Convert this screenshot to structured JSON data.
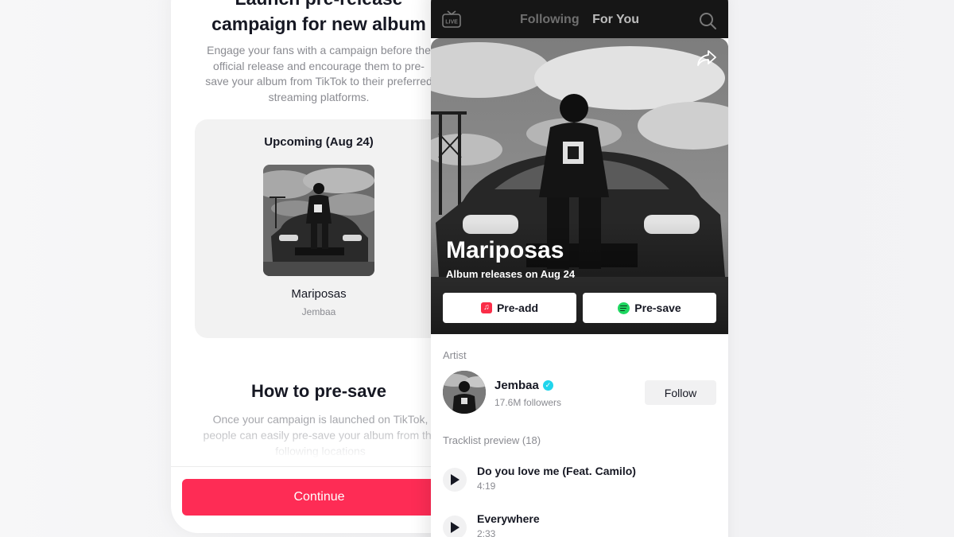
{
  "campaign": {
    "title_line1": "Launch pre-release",
    "title_line2": "campaign for new album",
    "description": "Engage your fans with a campaign before the official release and encourage them to pre-save your album from TikTok to their preferred streaming platforms.",
    "card_label": "Upcoming (Aug 24)",
    "album_name": "Mariposas",
    "artist_name": "Jembaa",
    "how_title": "How to pre-save",
    "how_description": "Once your campaign is launched on TikTok, people can easily pre-save your album from the following locations",
    "continue_label": "Continue",
    "accent_color": "#fe2c55"
  },
  "feed": {
    "live_icon": "live-tv-icon",
    "tabs": [
      {
        "label": "Following",
        "active": false
      },
      {
        "label": "For You",
        "active": true
      }
    ],
    "search_icon": "search-icon",
    "share_icon": "share-arrow-icon"
  },
  "album": {
    "title": "Mariposas",
    "release_text": "Album releases on Aug 24",
    "preadd_label": "Pre-add",
    "presave_label": "Pre-save",
    "preadd_icon": "apple-music-icon",
    "presave_icon": "spotify-icon"
  },
  "artist": {
    "section_label": "Artist",
    "name": "Jembaa",
    "verified": true,
    "followers": "17.6M followers",
    "follow_label": "Follow"
  },
  "tracklist": {
    "section_label": "Tracklist preview (18)",
    "tracks": [
      {
        "title": "Do you love me (Feat. Camilo)",
        "duration": "4:19"
      },
      {
        "title": "Everywhere",
        "duration": "2:33"
      }
    ]
  },
  "colors": {
    "verified_badge": "#20d5ec",
    "apple_music": "#fa2d48",
    "spotify": "#1ed760"
  }
}
